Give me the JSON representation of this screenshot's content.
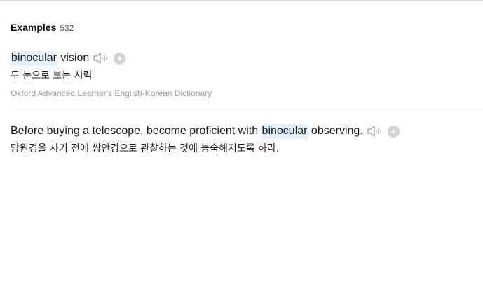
{
  "examples_section": {
    "title": "Examples",
    "count": "532"
  },
  "examples": [
    {
      "highlight": "binocular",
      "rest": " vision",
      "translation": "두 눈으로 보는 시력",
      "source": "Oxford Advanced Learner's English-Korean Dictionary"
    },
    {
      "before": "Before buying a telescope, become proficient with ",
      "highlight": "binocular",
      "after": " observing.",
      "translation": "망원경을 사기 전에 쌍안경으로 관찰하는 것에 능숙해지도록 하라."
    }
  ],
  "icons": {
    "speaker": "speaker-icon",
    "add": "plus-circle-icon"
  },
  "colors": {
    "highlight": "#e3effa",
    "source_text": "#9a9a9a",
    "add_button": "#d3d3d3"
  }
}
